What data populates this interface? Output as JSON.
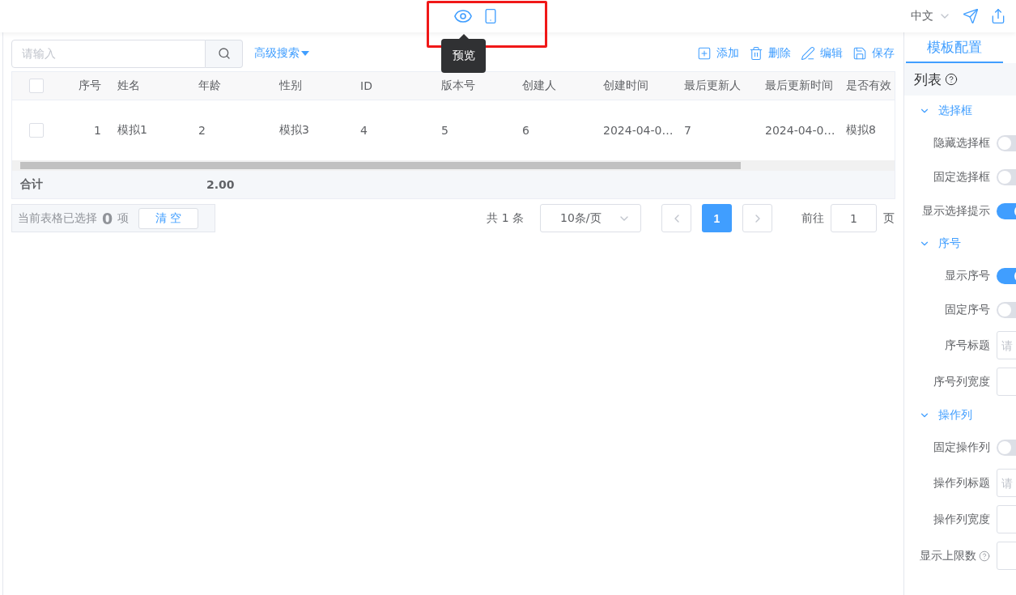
{
  "header": {
    "tooltip": "预览",
    "language": "中文"
  },
  "toolbar": {
    "search": {
      "placeholder": "请输入"
    },
    "advanced_search": "高级搜索",
    "actions": [
      {
        "kind": "add",
        "label": "添加"
      },
      {
        "kind": "delete",
        "label": "删除"
      },
      {
        "kind": "edit",
        "label": "编辑"
      },
      {
        "kind": "save",
        "label": "保存"
      }
    ]
  },
  "table": {
    "select_all": {
      "checked": false
    },
    "columns": [
      "序号",
      "姓名",
      "年龄",
      "性别",
      "ID",
      "版本号",
      "创建人",
      "创建时间",
      "最后更新人",
      "最后更新时间",
      "是否有效"
    ],
    "rows": [
      {
        "checked": false,
        "cells": [
          "1",
          "模拟1",
          "2",
          "模拟3",
          "4",
          "5",
          "6",
          "2024-04-0…",
          "7",
          "2024-04-0…",
          "模拟8"
        ]
      }
    ],
    "summary": {
      "label": "合计",
      "value": "2.00"
    }
  },
  "footer": {
    "selection_text": "当前表格已选择",
    "selection_count": "0",
    "selection_unit": "项",
    "clear": "清 空",
    "total": "共 1 条",
    "page_size": "10条/页",
    "pages": [
      {
        "label": "1",
        "selected": true
      }
    ],
    "goto_label": "前往",
    "goto_value": "1",
    "goto_unit": "页"
  },
  "panel": {
    "tab": "模板配置",
    "section": "列表",
    "groups": [
      {
        "title": "选择框",
        "expanded": true,
        "items": [
          {
            "kind": "switch",
            "label": "隐藏选择框",
            "on": false
          },
          {
            "kind": "switch",
            "label": "固定选择框",
            "on": false
          },
          {
            "kind": "switch",
            "label": "显示选择提示",
            "on": true
          }
        ]
      },
      {
        "title": "序号",
        "expanded": true,
        "items": [
          {
            "kind": "switch",
            "label": "显示序号",
            "on": true
          },
          {
            "kind": "switch",
            "label": "固定序号",
            "on": false
          },
          {
            "kind": "input",
            "label": "序号标题",
            "placeholder": "请"
          },
          {
            "kind": "input",
            "label": "序号列宽度"
          }
        ]
      },
      {
        "title": "操作列",
        "expanded": true,
        "items": [
          {
            "kind": "switch",
            "label": "固定操作列",
            "on": false
          },
          {
            "kind": "input",
            "label": "操作列标题",
            "placeholder": "请"
          },
          {
            "kind": "input",
            "label": "操作列宽度"
          },
          {
            "kind": "input",
            "label": "显示上限数",
            "help": true
          }
        ]
      }
    ]
  }
}
